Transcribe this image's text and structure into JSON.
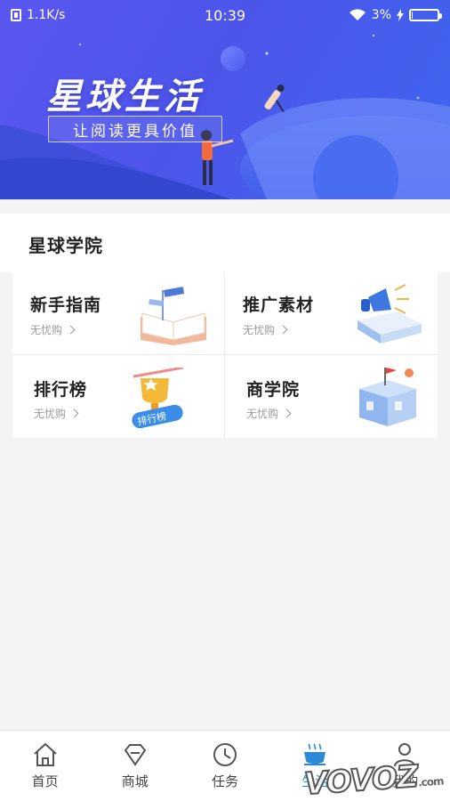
{
  "status_bar": {
    "network_speed": "1.1K/s",
    "time": "10:39",
    "battery_percent": "3%",
    "battery_level": 0.03
  },
  "banner": {
    "title": "星球生活",
    "subtitle": "让阅读更具价值"
  },
  "section": {
    "title": "星球学院",
    "cards": [
      {
        "title": "新手指南",
        "subtitle": "无忧购",
        "icon": "open-book-icon"
      },
      {
        "title": "推广素材",
        "subtitle": "无忧购",
        "icon": "megaphone-icon"
      },
      {
        "title": "排行榜",
        "subtitle": "无忧购",
        "icon": "trophy-icon",
        "badge": "排行榜"
      },
      {
        "title": "商学院",
        "subtitle": "无忧购",
        "icon": "school-building-icon"
      }
    ]
  },
  "bottom_nav": {
    "items": [
      {
        "label": "首页",
        "icon": "home-icon",
        "active": false
      },
      {
        "label": "商城",
        "icon": "diamond-icon",
        "active": false
      },
      {
        "label": "任务",
        "icon": "clock-icon",
        "active": false
      },
      {
        "label": "生活",
        "icon": "coffee-cup-icon",
        "active": true
      },
      {
        "label": "我的",
        "icon": "user-icon",
        "active": false
      }
    ]
  },
  "watermark": {
    "text": "VOVOZ",
    "suffix": ".com"
  },
  "colors": {
    "accent": "#2a8ad8",
    "banner_start": "#5b57f0",
    "banner_end": "#3e66ef"
  }
}
